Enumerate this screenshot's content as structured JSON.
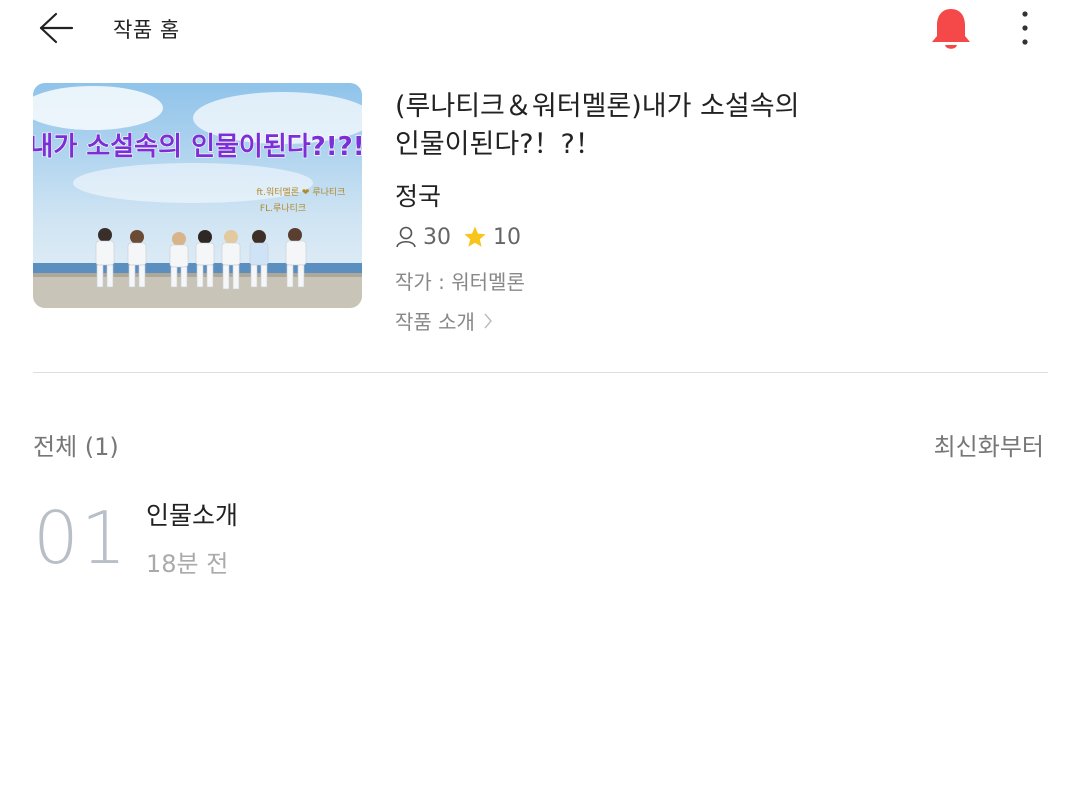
{
  "header": {
    "title": "작품 홈",
    "back_icon": "arrow-left-icon",
    "bell_icon": "bell-icon",
    "more_icon": "more-vertical-icon",
    "bell_color": "#f54848"
  },
  "work": {
    "cover": {
      "banner_text": "내가 소설속의 인물이된다?!?!",
      "banner_color": "#7b2fd6",
      "caption_line1": "ft.워터멜론 ❤ 루나티크",
      "caption_line2": "FL.루나티크"
    },
    "title": "(루나티크＆워터멜론)내가 소설속의 인물이된다?！?！",
    "hashtag": "정국",
    "readers": "30",
    "stars": "10",
    "author": "작가 : 워터멜론",
    "intro_link": "작품 소개"
  },
  "list": {
    "count_label": "전체 (1)",
    "sort_label": "최신화부터",
    "episodes": [
      {
        "number": "01",
        "title": "인물소개",
        "time": "18분 전"
      }
    ]
  }
}
